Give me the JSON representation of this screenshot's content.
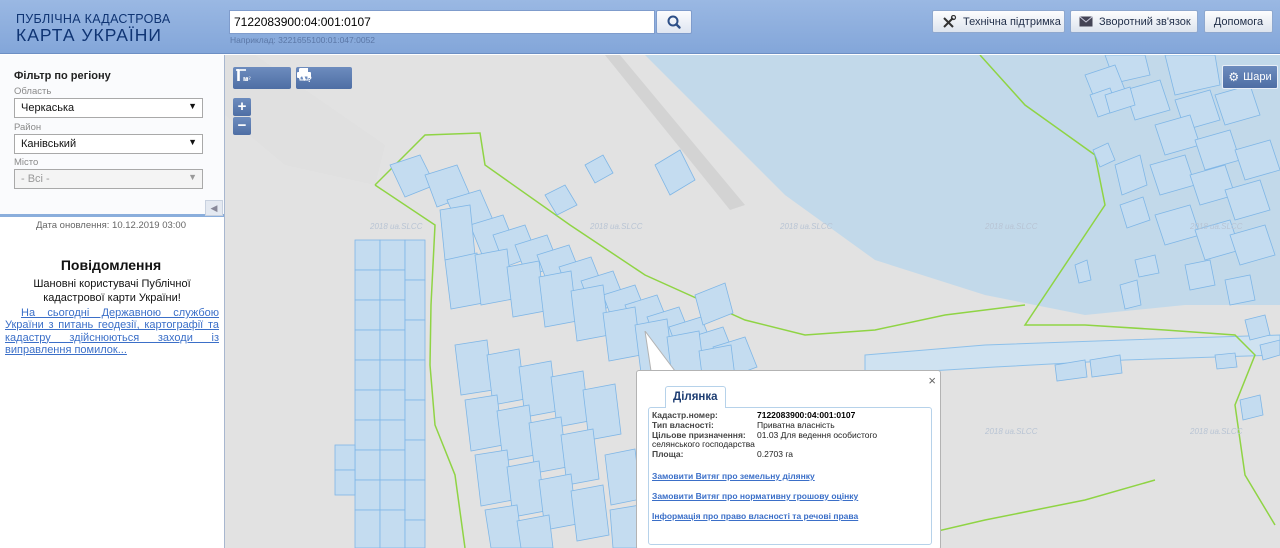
{
  "header": {
    "logo_line1": "ПУБЛІЧНА КАДАСТРОВА",
    "logo_line2": "КАРТА УКРАЇНИ",
    "search_value": "7122083900:04:001:0107",
    "search_hint": "Наприклад: 3221655100:01:047:0052",
    "tech_support": "Технічна підтримка",
    "feedback": "Зворотний зв'язок",
    "help": "Допомога"
  },
  "sidebar": {
    "filter_title": "Фільтр по регіону",
    "region_label": "Область",
    "region_value": "Черкаська",
    "district_label": "Район",
    "district_value": "Канівський",
    "city_label": "Місто",
    "city_value": "- Всі -",
    "update_date": "Дата оновлення: 10.12.2019 03:00",
    "news_title": "Повідомлення",
    "news_greeting": "Шановні користувачі Публічної кадастрової карти України!",
    "news_link": "На сьогодні Державною службою України з питань геодезії, картографії та кадастру здійснюються заходи із виправлення помилок..."
  },
  "map": {
    "layers_label": "Шари",
    "zoom_in": "+",
    "zoom_out": "−",
    "watermark": "2018 ua.SLCC",
    "tool_distance_label": "м",
    "tool_area_label": "м²"
  },
  "popup": {
    "tab": "Ділянка",
    "close": "×",
    "cad_label": "Кадастр.номер:",
    "cad_value": "7122083900:04:001:0107",
    "owner_label": "Тип власності:",
    "owner_value": "Приватна власність",
    "purpose_label": "Цільове призначення:",
    "purpose_value1": "01.03 Для ведення особистого",
    "purpose_value2": "селянського господарства",
    "area_label": "Площа:",
    "area_value": "0.2703 га",
    "link1": "Замовити Витяг про земельну ділянку",
    "link2": "Замовити Витяг про нормативну грошову оцінку",
    "link3": "Інформація про право власності та речові права"
  },
  "colors": {
    "header": "#8fb0df",
    "parcel_fill": "#c4dcf0",
    "parcel_stroke": "#7fb6e6",
    "boundary": "#8fd444",
    "link": "#3b6fc8"
  }
}
